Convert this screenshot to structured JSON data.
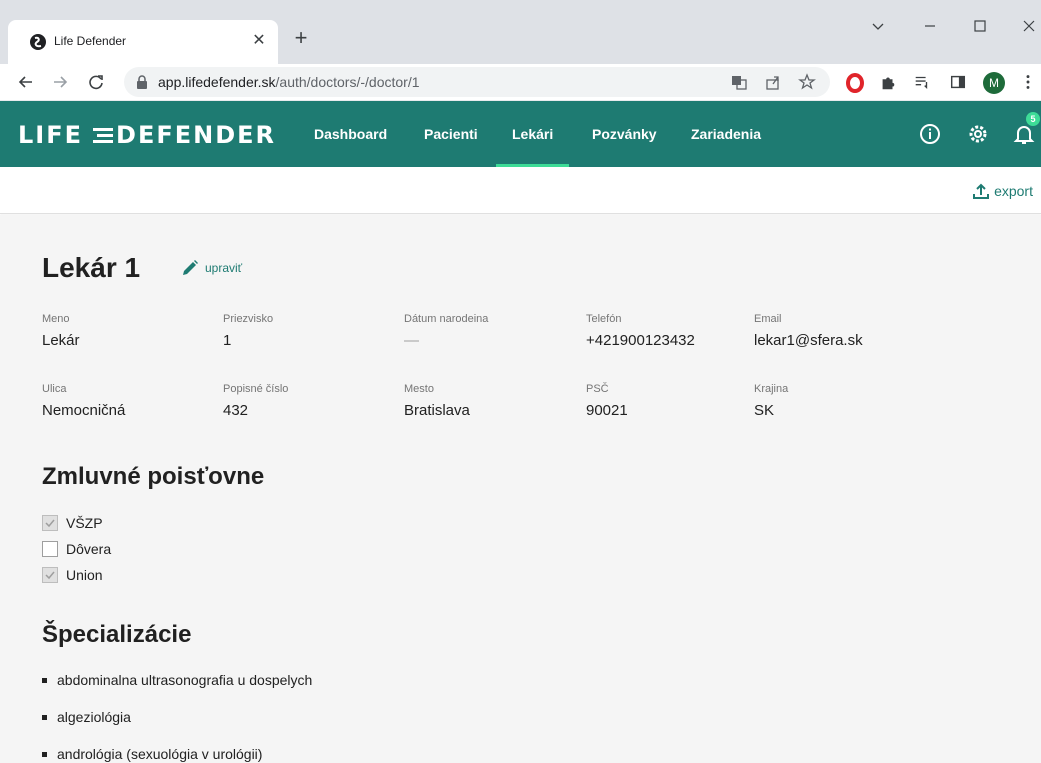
{
  "browser": {
    "tab_title": "Life Defender",
    "url_host": "app.lifedefender.sk",
    "url_path": "/auth/doctors/-/doctor/1",
    "profile_initial": "M"
  },
  "app": {
    "logo_left": "LIFE",
    "logo_right": "DEFENDER",
    "nav": [
      "Dashboard",
      "Pacienti",
      "Lekári",
      "Pozvánky",
      "Zariadenia"
    ],
    "active_nav": "Lekári",
    "notification_count": "5",
    "accent_color": "#1e7b72",
    "active_underline_color": "#3ddc97"
  },
  "toolbar": {
    "export_label": "export"
  },
  "doctor": {
    "title": "Lekár 1",
    "edit_label": "upraviť",
    "fields_row1": [
      {
        "label": "Meno",
        "value": "Lekár"
      },
      {
        "label": "Priezvisko",
        "value": "1"
      },
      {
        "label": "Dátum narodeina",
        "value": "—"
      },
      {
        "label": "Telefón",
        "value": "+421900123432"
      },
      {
        "label": "Email",
        "value": "lekar1@sfera.sk"
      }
    ],
    "fields_row2": [
      {
        "label": "Ulica",
        "value": "Nemocničná"
      },
      {
        "label": "Popisné číslo",
        "value": "432"
      },
      {
        "label": "Mesto",
        "value": "Bratislava"
      },
      {
        "label": "PSČ",
        "value": "90021"
      },
      {
        "label": "Krajina",
        "value": "SK"
      }
    ]
  },
  "insurers": {
    "title": "Zmluvné poisťovne",
    "items": [
      {
        "label": "VŠZP",
        "checked": true
      },
      {
        "label": "Dôvera",
        "checked": false
      },
      {
        "label": "Union",
        "checked": true
      }
    ]
  },
  "specializations": {
    "title": "Špecializácie",
    "items": [
      "abdominalna ultrasonografia u dospelych",
      "algeziológia",
      "andrológia (sexuológia v urológii)"
    ]
  }
}
